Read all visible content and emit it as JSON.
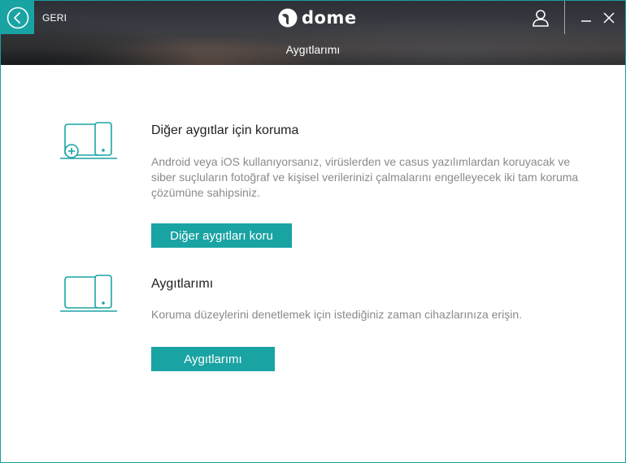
{
  "header": {
    "back_label": "GERI",
    "logo_text": "dome",
    "page_title": "Aygıtlarımı"
  },
  "sections": [
    {
      "title": "Diğer aygıtlar için koruma",
      "description": "Android veya iOS kullanıyorsanız, virüslerden ve casus yazılımlardan koruyacak ve siber suçluların fotoğraf ve kişisel verilerinizi çalmalarını engelleyecek iki tam koruma çözümüne sahipsiniz.",
      "button_label": "Diğer aygıtları koru",
      "icon": "devices-add-icon"
    },
    {
      "title": "Aygıtlarımı",
      "description": "Koruma düzeylerini denetlemek için istediğiniz zaman cihazlarınıza erişin.",
      "button_label": "Aygıtlarımı",
      "icon": "devices-icon"
    }
  ],
  "colors": {
    "accent": "#1aa3a3",
    "title_text": "#1f1f1f",
    "body_text": "#8a8a8a"
  }
}
